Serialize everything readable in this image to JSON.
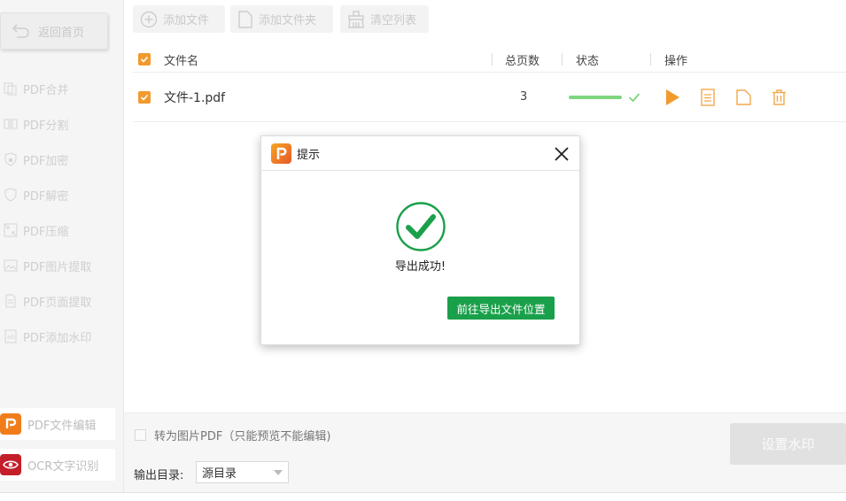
{
  "sidebar": {
    "back_label": "返回首页",
    "items": [
      {
        "label": "PDF合并",
        "icon": "merge-icon"
      },
      {
        "label": "PDF分割",
        "icon": "split-icon"
      },
      {
        "label": "PDF加密",
        "icon": "lock-shield-icon"
      },
      {
        "label": "PDF解密",
        "icon": "unlock-shield-icon"
      },
      {
        "label": "PDF压缩",
        "icon": "compress-icon"
      },
      {
        "label": "PDF图片提取",
        "icon": "image-icon"
      },
      {
        "label": "PDF页面提取",
        "icon": "page-icon"
      },
      {
        "label": "PDF添加水印",
        "icon": "watermark-icon"
      }
    ],
    "tools": [
      {
        "label": "PDF文件编辑",
        "icon": "pdf-editor-logo-icon",
        "color": "#f07d1a"
      },
      {
        "label": "OCR文字识别",
        "icon": "ocr-eye-icon",
        "color": "#c41e2a"
      }
    ]
  },
  "toolbar": {
    "add_file": "添加文件",
    "add_folder": "添加文件夹",
    "clear_list": "清空列表"
  },
  "table": {
    "headers": {
      "name": "文件名",
      "pages": "总页数",
      "status": "状态",
      "actions": "操作"
    },
    "rows": [
      {
        "name": "文件-1.pdf",
        "pages": "3",
        "progress": 1.0
      }
    ]
  },
  "bottom": {
    "image_pdf_label": "转为图片PDF（只能预览不能编辑)",
    "output_label": "输出目录:",
    "output_value": "源目录",
    "watermark_button": "设置水印"
  },
  "dialog": {
    "title": "提示",
    "message": "导出成功!",
    "open_location_button": "前往导出文件位置"
  },
  "colors": {
    "accent": "#f29a2e",
    "success": "#1aa04b",
    "progress": "#7ed67e"
  }
}
